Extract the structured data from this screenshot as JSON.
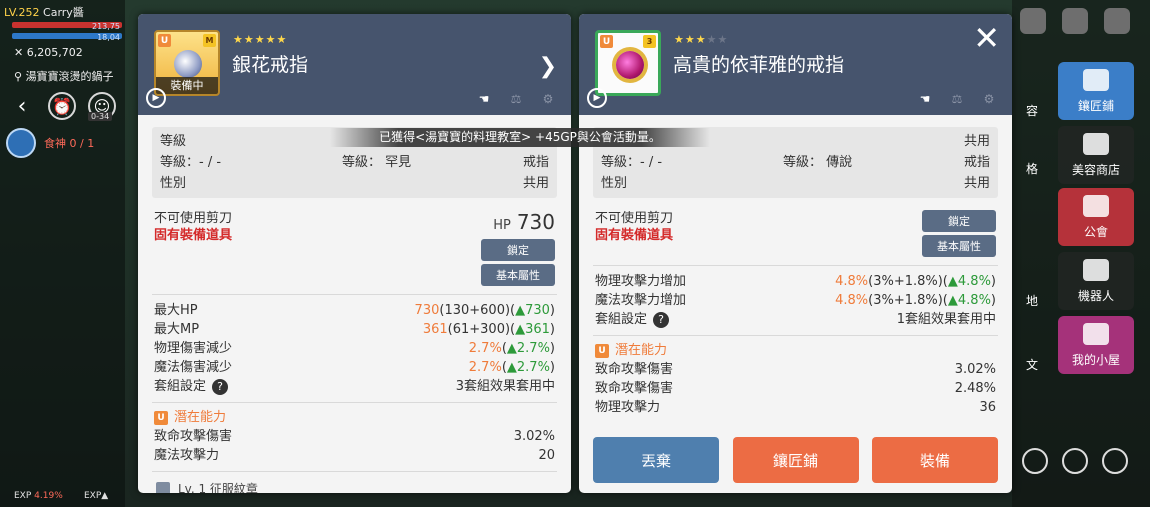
{
  "hud": {
    "level": "LV.252",
    "name": "Carry醬",
    "hp_text": "213,75",
    "mp_text": "18,04",
    "meso": "6,205,702",
    "map_name": "湯寶寶滾燙的鍋子",
    "stamp": "0-34",
    "quest_text": "食神 0 / 1",
    "exp_label": "EXP",
    "exp_value": "4.19%",
    "exp_label2": "EXP▲"
  },
  "right_menu": {
    "tiles": [
      {
        "label": "鑲匠鋪"
      },
      {
        "label": "美容商店"
      },
      {
        "label": "公會"
      },
      {
        "label": "機器人"
      },
      {
        "label": "我的小屋"
      }
    ],
    "partials": [
      "容",
      "格",
      "地",
      "文"
    ]
  },
  "notice": "已獲得<湯寶寶的料理教室> +45GP與公會活動量。",
  "left_item": {
    "stars": "★★★★★",
    "stars_dim": "",
    "name": "銀花戒指",
    "grade": "U",
    "mark": "M",
    "equipped_label": "裝備中",
    "info": {
      "row1_label": "等級",
      "row2_left": "等級：- / -",
      "row2_mid": "等級： 罕見",
      "row2_right": "戒指",
      "row3_label": "性別",
      "row3_right": "共用"
    },
    "props": {
      "no_scissors": "不可使用剪刀",
      "unique_equip": "固有裝備道具",
      "hp_label": "HP",
      "hp_value": "730",
      "lock_btn": "鎖定",
      "base_attr_btn": "基本屬性"
    },
    "stats": [
      {
        "label": "最大HP",
        "value": "730",
        "detail": "(130+600)(",
        "gain": "▲730",
        "tail": ")"
      },
      {
        "label": "最大MP",
        "value": "361",
        "detail": "(61+300)(",
        "gain": "▲361",
        "tail": ")"
      },
      {
        "label": "物理傷害減少",
        "value": "2.7%",
        "detail": "(",
        "gain": "▲2.7%",
        "tail": ")"
      },
      {
        "label": "魔法傷害減少",
        "value": "2.7%",
        "detail": "(",
        "gain": "▲2.7%",
        "tail": ")"
      }
    ],
    "set_label": "套組設定",
    "set_value": "3套組效果套用中",
    "potential_title": "潛在能力",
    "potentials": [
      {
        "label": "致命攻擊傷害",
        "value": "3.02%"
      },
      {
        "label": "魔法攻擊力",
        "value": "20"
      }
    ],
    "emblem": "Lv. 1 征服紋章"
  },
  "right_item": {
    "stars": "★★★",
    "stars_dim": "★★",
    "name": "高貴的依菲雅的戒指",
    "grade": "U",
    "mark": "3",
    "info": {
      "row1_right": "共用",
      "row2_left": "等級：- / -",
      "row2_mid": "等級： 傳說",
      "row2_right": "戒指",
      "row3_label": "性別",
      "row3_right": "共用"
    },
    "props": {
      "no_scissors": "不可使用剪刀",
      "unique_equip": "固有裝備道具",
      "lock_btn": "鎖定",
      "base_attr_btn": "基本屬性"
    },
    "stats": [
      {
        "label": "物理攻擊力增加",
        "value": "4.8%",
        "detail": "(3%+1.8%)(",
        "gain": "▲4.8%",
        "tail": ")"
      },
      {
        "label": "魔法攻擊力增加",
        "value": "4.8%",
        "detail": "(3%+1.8%)(",
        "gain": "▲4.8%",
        "tail": ")"
      }
    ],
    "set_label": "套組設定",
    "set_value": "1套組效果套用中",
    "potential_title": "潛在能力",
    "potentials": [
      {
        "label": "致命攻擊傷害",
        "value": "3.02%"
      },
      {
        "label": "致命攻擊傷害",
        "value": "2.48%"
      },
      {
        "label": "物理攻擊力",
        "value": "36"
      }
    ],
    "buttons": {
      "discard": "丟棄",
      "smith": "鑲匠鋪",
      "equip": "裝備"
    }
  },
  "colors": {
    "header_bg": "#46546d",
    "stat_orange": "#ef7b3a",
    "stat_green": "#2d9a3a",
    "unique_red": "#d42a2a",
    "btn_blue": "#4f7fae",
    "btn_orange": "#ec6c44"
  }
}
